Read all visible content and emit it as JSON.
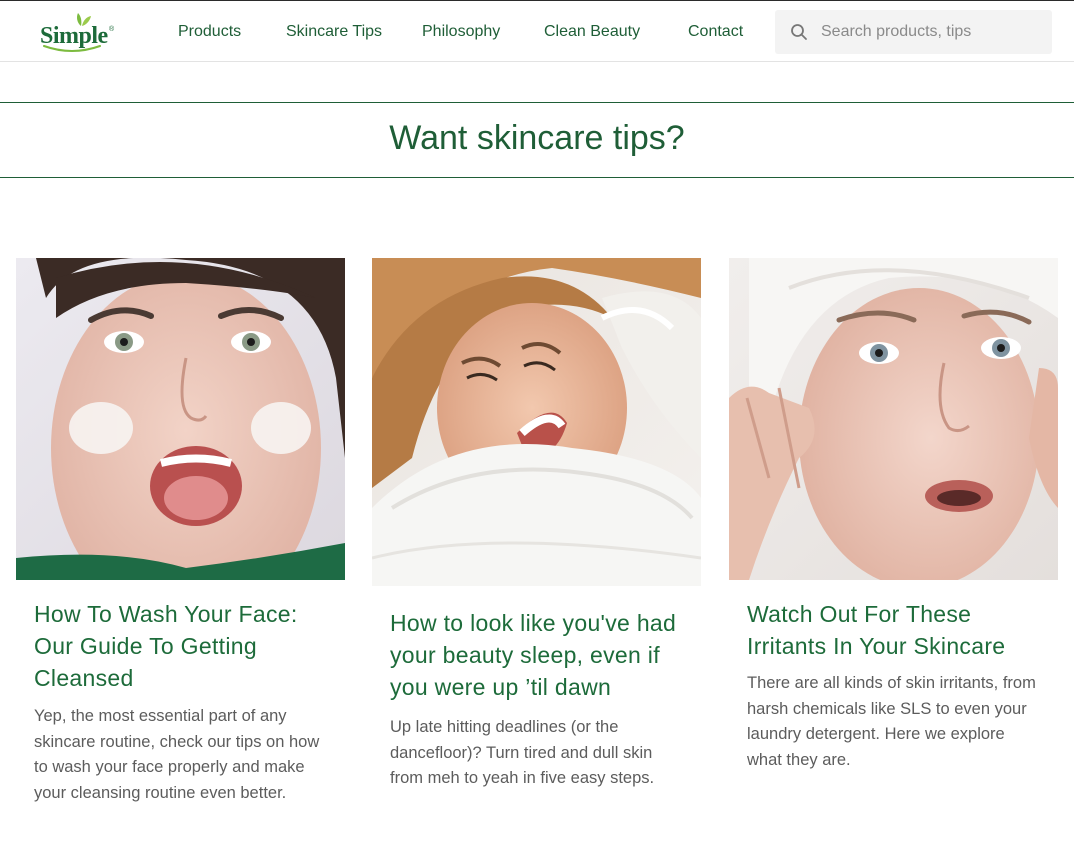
{
  "header": {
    "logo_text": "Simple",
    "logo_mark": "®",
    "nav": [
      "Products",
      "Skincare Tips",
      "Philosophy",
      "Clean Beauty",
      "Contact"
    ],
    "search": {
      "placeholder": "Search products, tips",
      "value": "",
      "icon": "search-icon"
    }
  },
  "hero": {
    "title": "Want skincare tips?"
  },
  "cards": [
    {
      "image": "woman-applying-face-cleanser-photo",
      "title": "How To Wash Your Face: Our Guide To Getting Cleansed",
      "text": "Yep, the most essential part of any skincare routine, check our tips on how to wash your face properly and make your cleansing routine even better."
    },
    {
      "image": "woman-smiling-on-pillow-photo",
      "title": "How to look like you've had your beauty sleep, even if you were up ’til dawn",
      "text": "Up late hitting deadlines (or the dancefloor)? Turn tired and dull skin from meh to yeah in five easy steps."
    },
    {
      "image": "woman-with-towel-touching-face-photo",
      "title": "Watch Out For These Irritants In Your Skincare",
      "text": "There are all kinds of skin irritants, from harsh chemicals like SLS to even your laundry detergent. Here we explore what they are."
    }
  ],
  "colors": {
    "brand_green": "#1f5e37",
    "body_text": "#5c5c5c",
    "search_bg": "#f3f3f3"
  }
}
